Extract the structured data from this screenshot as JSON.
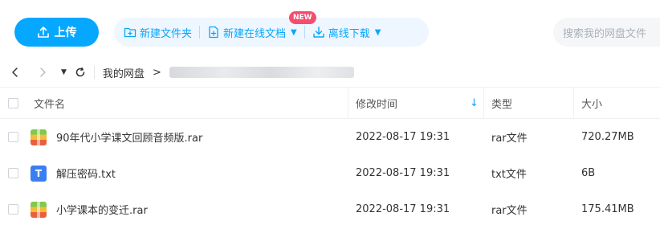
{
  "colors": {
    "accent": "#06a7ff",
    "badge": "#f54d6f"
  },
  "toolbar": {
    "upload_label": "上传",
    "new_folder_label": "新建文件夹",
    "new_online_doc_label": "新建在线文档",
    "new_badge": "NEW",
    "offline_download_label": "离线下载",
    "search_placeholder": "搜索我的网盘文件"
  },
  "nav": {
    "breadcrumb_root": "我的网盘",
    "breadcrumb_separator": ">"
  },
  "table": {
    "headers": {
      "name": "文件名",
      "modified": "修改时间",
      "type": "类型",
      "size": "大小"
    },
    "sort_icon": "arrow-down-icon",
    "rows": [
      {
        "icon": "rar-file-icon",
        "name": "90年代小学课文回顾音频版.rar",
        "modified": "2022-08-17 19:31",
        "type": "rar文件",
        "size": "720.27MB"
      },
      {
        "icon": "txt-file-icon",
        "icon_letter": "T",
        "name": "解压密码.txt",
        "modified": "2022-08-17 19:31",
        "type": "txt文件",
        "size": "6B"
      },
      {
        "icon": "rar-file-icon",
        "name": "小学课本的变迁.rar",
        "modified": "2022-08-17 19:31",
        "type": "rar文件",
        "size": "175.41MB"
      }
    ]
  }
}
